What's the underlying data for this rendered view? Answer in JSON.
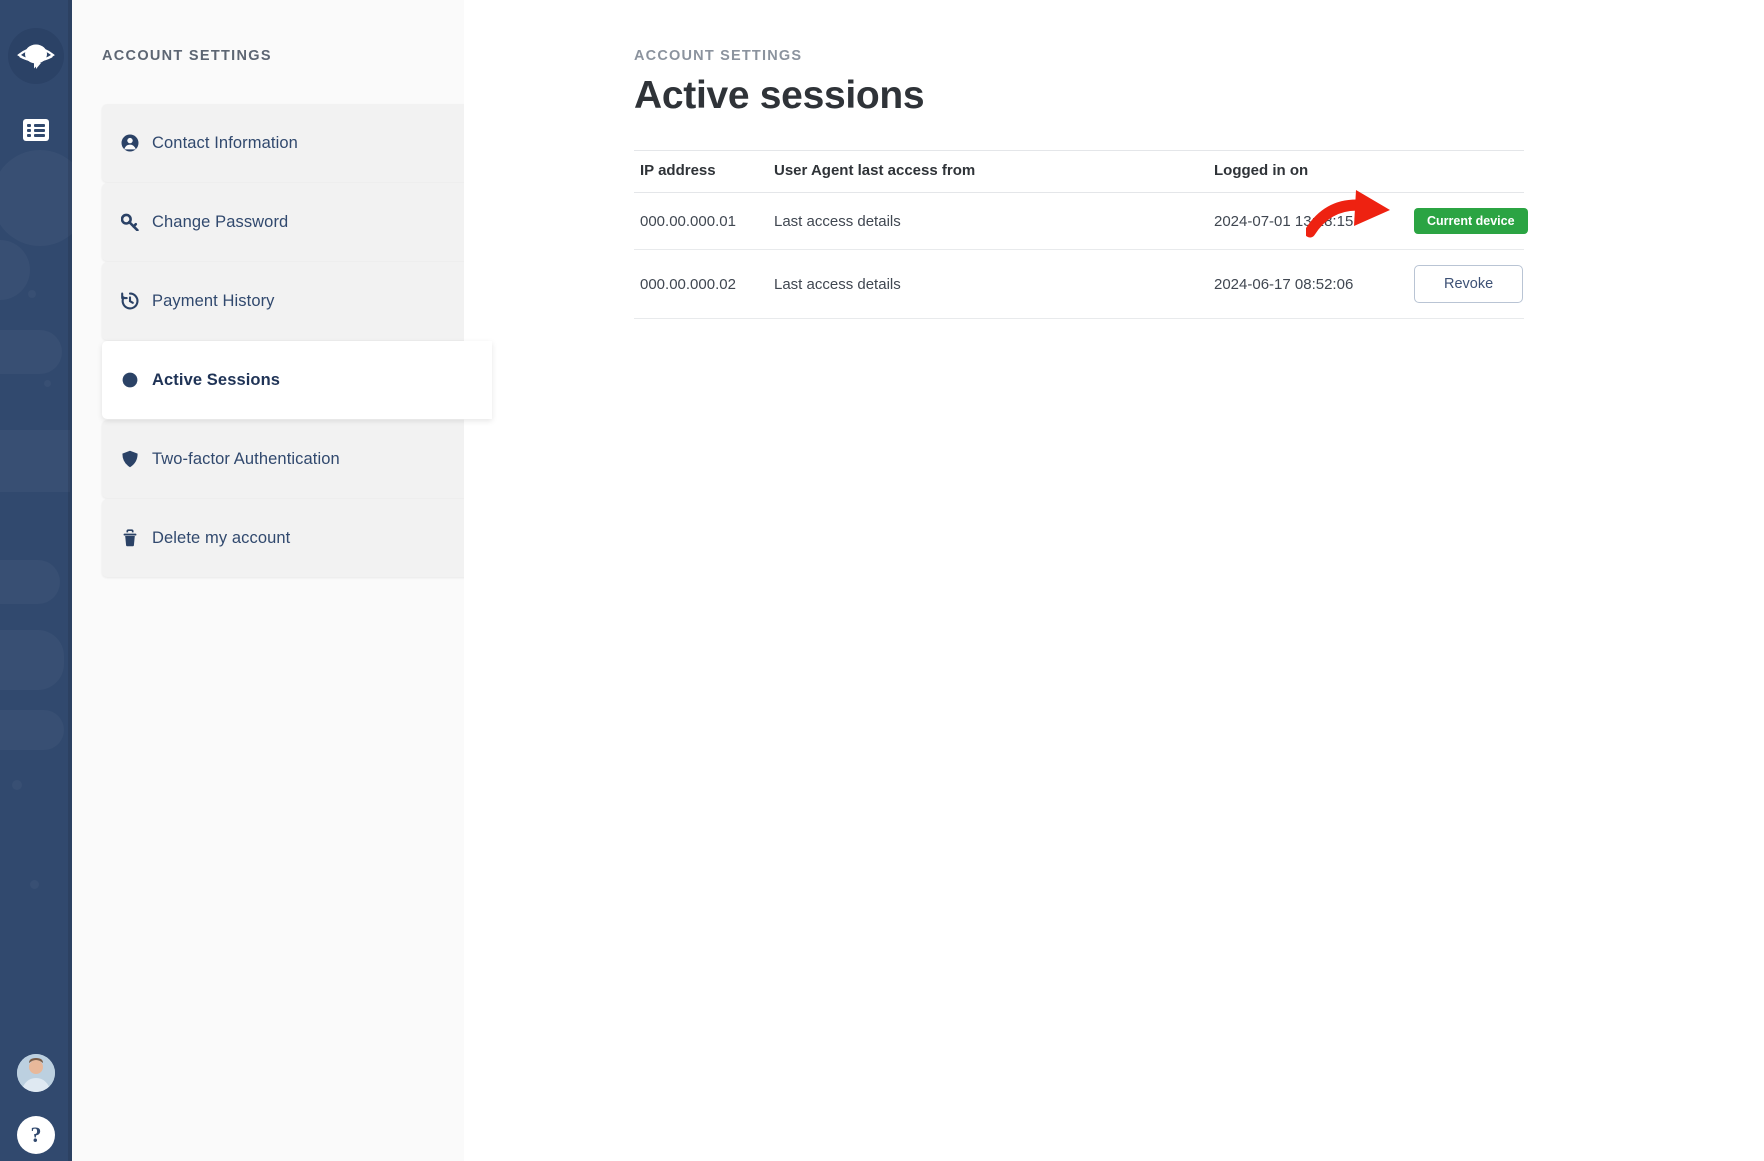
{
  "rail": {
    "logo_icon": "planet-logo-icon",
    "items": [
      {
        "name": "rail-item-list",
        "icon": "list-icon"
      }
    ],
    "avatar": {
      "name": "user-avatar",
      "alt": "User avatar"
    },
    "help": {
      "label": "?",
      "name": "help-icon"
    }
  },
  "sidebar": {
    "heading": "ACCOUNT SETTINGS",
    "items": [
      {
        "label": "Contact Information",
        "icon": "user-circle-icon",
        "active": false
      },
      {
        "label": "Change Password",
        "icon": "key-icon",
        "active": false
      },
      {
        "label": "Payment History",
        "icon": "history-icon",
        "active": false
      },
      {
        "label": "Active Sessions",
        "icon": "circle-icon",
        "active": true
      },
      {
        "label": "Two-factor Authentication",
        "icon": "shield-icon",
        "active": false
      },
      {
        "label": "Delete my account",
        "icon": "trash-icon",
        "active": false
      }
    ]
  },
  "main": {
    "eyebrow": "ACCOUNT SETTINGS",
    "title": "Active sessions",
    "table": {
      "columns": [
        "IP address",
        "User Agent last access from",
        "Logged in on",
        ""
      ],
      "rows": [
        {
          "ip": "000.00.000.01",
          "user_agent": "Last access details",
          "logged_in_on": "2024-07-01 13:18:15",
          "action_type": "badge",
          "action_label": "Current device"
        },
        {
          "ip": "000.00.000.02",
          "user_agent": "Last access details",
          "logged_in_on": "2024-06-17 08:52:06",
          "action_type": "button",
          "action_label": "Revoke"
        }
      ]
    }
  },
  "annotations": [
    {
      "name": "annotation-arrow-to-ip-column",
      "direction": "right",
      "color": "#ee2211"
    },
    {
      "name": "annotation-arrow-to-action-column",
      "direction": "down-left",
      "color": "#ee2211"
    }
  ],
  "colors": {
    "rail_bg": "#31496e",
    "sidebar_bg": "#fafafa",
    "accent_navy": "#31496e",
    "success_green": "#2ba443",
    "annotation_red": "#ee2211"
  }
}
